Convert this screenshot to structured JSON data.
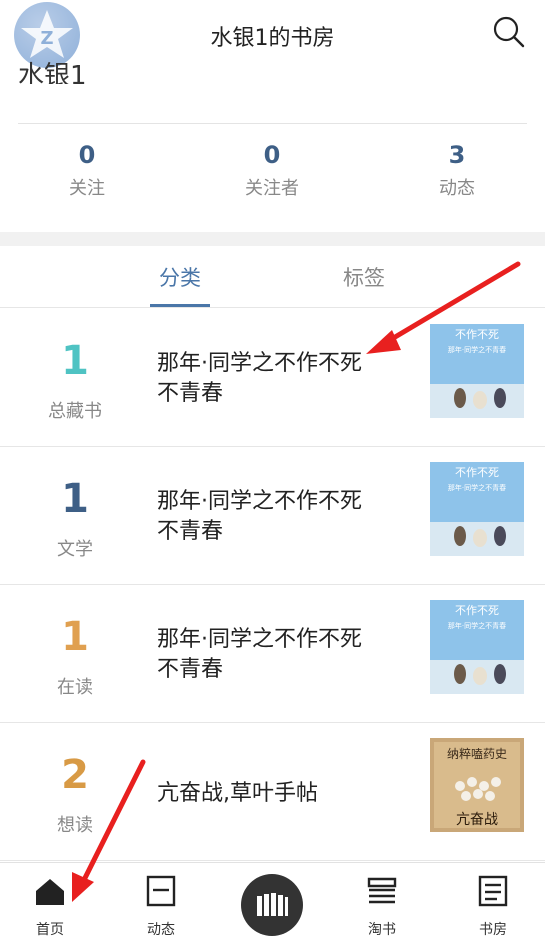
{
  "header": {
    "title": "水银1的书房",
    "user_name_partial": "水银1"
  },
  "stats": [
    {
      "count": "0",
      "label": "关注"
    },
    {
      "count": "0",
      "label": "关注者"
    },
    {
      "count": "3",
      "label": "动态"
    }
  ],
  "tabs": [
    {
      "label": "分类",
      "active": true
    },
    {
      "label": "标签",
      "active": false
    }
  ],
  "rows": [
    {
      "count": "1",
      "category": "总藏书",
      "book": "那年·同学之不作不死不青春",
      "count_color": "#4fc3c3"
    },
    {
      "count": "1",
      "category": "文学",
      "book": "那年·同学之不作不死不青春",
      "count_color": "#3e5f86"
    },
    {
      "count": "1",
      "category": "在读",
      "book": "那年·同学之不作不死不青春",
      "count_color": "#e0a050"
    },
    {
      "count": "2",
      "category": "想读",
      "book": "亢奋战,草叶手帖",
      "count_color": "#d89a45"
    }
  ],
  "covers": {
    "youth_title": "不作不死",
    "youth_subtitle": "那年·同学之不青春",
    "war_title": "纳粹嗑药史",
    "war_subtitle": "亢奋战"
  },
  "nav": [
    {
      "label": "首页",
      "icon": "home-icon"
    },
    {
      "label": "动态",
      "icon": "news-icon"
    },
    {
      "label": "",
      "icon": "bookshelf-icon"
    },
    {
      "label": "淘书",
      "icon": "shop-icon"
    },
    {
      "label": "书房",
      "icon": "study-icon"
    }
  ],
  "colors": {
    "accent": "#4a76a8",
    "stat_number": "#3e5f86",
    "annotation_arrow": "#e8201f"
  }
}
